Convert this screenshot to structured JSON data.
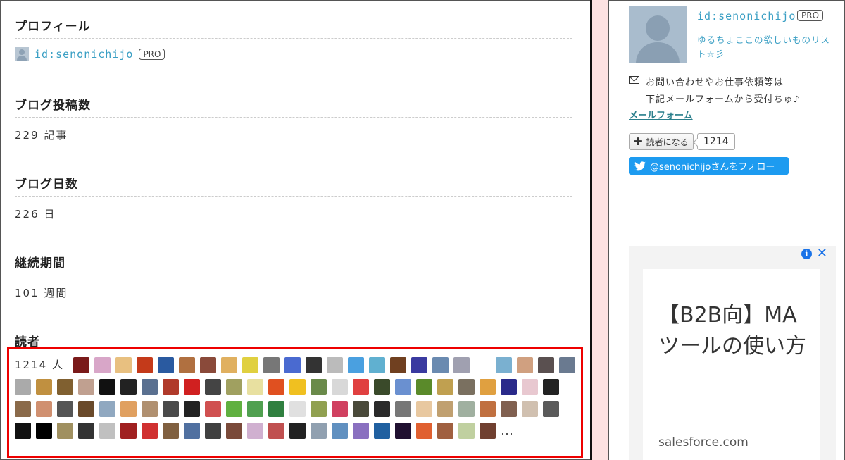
{
  "profile": {
    "title": "プロフィール",
    "user_id": "id:senonichijo",
    "badge": "PRO"
  },
  "posts": {
    "title": "ブログ投稿数",
    "value": "229 記事"
  },
  "days": {
    "title": "ブログ日数",
    "value": "226 日"
  },
  "period": {
    "title": "継続期間",
    "value": "101 週間"
  },
  "readers": {
    "title": "読者",
    "count": "1214 人",
    "more": "…",
    "icons": [
      "#7a1a1a",
      "#d8a6c8",
      "#e8c080",
      "#c43a1a",
      "#2a5aa0",
      "#b07040",
      "#8a4a3a",
      "#e0b060",
      "#e0d040",
      "#777",
      "#4a6ad0",
      "#333",
      "#bbb",
      "#4aa0e0",
      "#60b0d0",
      "#704020",
      "#3a3aa0",
      "#6a8ab0",
      "#a0a0b0",
      "#fff",
      "#7ab0d0",
      "#d0a080",
      "#5a5050",
      "#6a7a90",
      "#aaa",
      "#c09040",
      "#806030",
      "#c0a090",
      "#111",
      "#222",
      "#5a7090",
      "#b03a2a",
      "#d02020",
      "#444",
      "#a0a060",
      "#e8e0a0",
      "#e05020",
      "#f0c020",
      "#6a8a4a",
      "#d8d8d8",
      "#e04040",
      "#3a4a2a",
      "#6a90d0",
      "#5a8a2a",
      "#c0a050",
      "#7a7060",
      "#e0a040",
      "#2a2a8a",
      "#e8c8d0",
      "#222",
      "#8a6a4a",
      "#d09070",
      "#555",
      "#6a4a2a",
      "#90a8c0",
      "#e0a060",
      "#b09070",
      "#4a4a4a",
      "#222",
      "#d05050",
      "#60b040",
      "#50a050",
      "#308040",
      "#e0e0e0",
      "#90a050",
      "#d04060",
      "#4a4a3a",
      "#2a2a2a",
      "#777",
      "#e8c8a0",
      "#c0a070",
      "#a0b0a0",
      "#c07040",
      "#806050",
      "#d0c0b0",
      "#5a5a5a",
      "#111",
      "#000",
      "#a09060",
      "#333",
      "#c0c0c0",
      "#a02020",
      "#d03030",
      "#806040",
      "#5070a0",
      "#404040",
      "#7a4a3a",
      "#d0b0d0",
      "#c05050",
      "#222",
      "#90a0b0",
      "#6090c0",
      "#8a70c0",
      "#2060a0",
      "#201030",
      "#e06030",
      "#a06040",
      "#c0d0a0",
      "#704030"
    ]
  },
  "sidebar": {
    "user_id": "id:senonichijo",
    "badge": "PRO",
    "description": "ゆるちょここの欲しいものリスト☆彡",
    "contact_line1": "お問い合わせやお仕事依頼等は",
    "contact_line2": "下記メールフォームから受付ちゅ♪",
    "mail_link": "メールフォーム",
    "subscribe_label": "読者になる",
    "subscriber_count": "1214",
    "twitter_label": "@senonichijoさんをフォロー"
  },
  "ad": {
    "title": "【B2B向】MAツールの使い方",
    "domain": "salesforce.com"
  },
  "colors": {
    "link": "#3a9fc4",
    "highlight_border": "#e00000",
    "twitter": "#1d9bf0",
    "divider_pink": "#fde2e2"
  }
}
